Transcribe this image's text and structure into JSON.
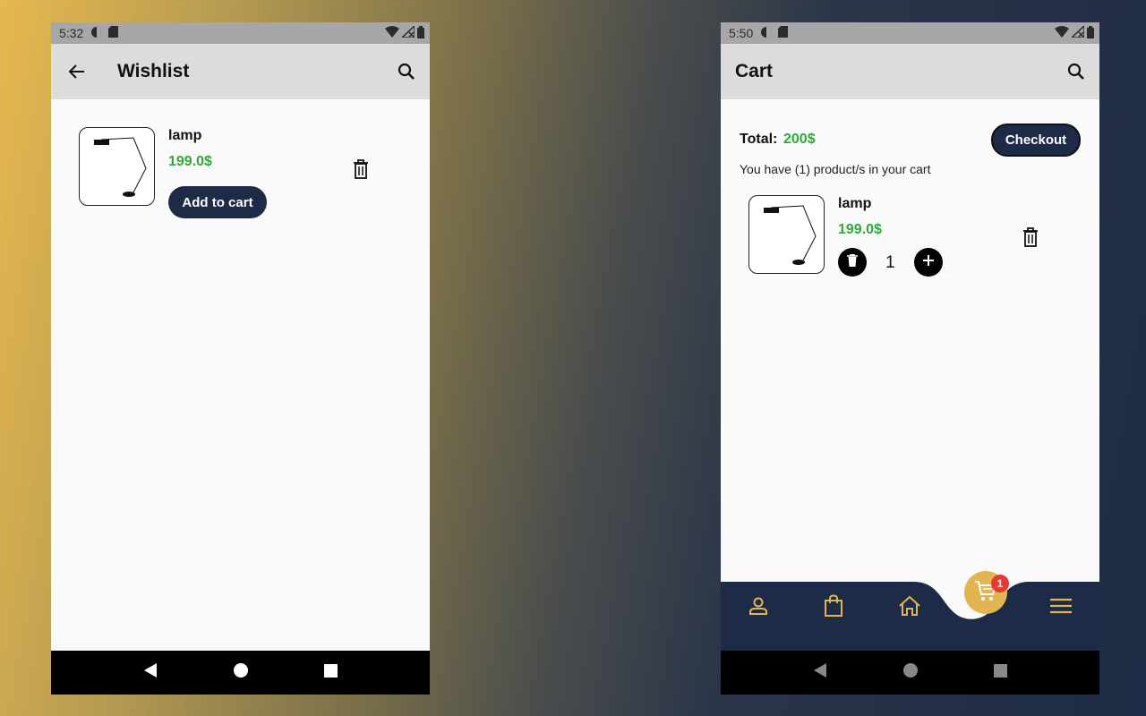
{
  "wishlist_screen": {
    "status": {
      "time": "5:32"
    },
    "appbar": {
      "title": "Wishlist"
    },
    "item": {
      "name": "lamp",
      "price": "199.0$",
      "add_to_cart_label": "Add to cart"
    }
  },
  "cart_screen": {
    "status": {
      "time": "5:50"
    },
    "appbar": {
      "title": "Cart"
    },
    "total_label": "Total:",
    "total_value": "200$",
    "checkout_label": "Checkout",
    "count_text": "You have (1) product/s in your cart",
    "item": {
      "name": "lamp",
      "price": "199.0$",
      "quantity": "1"
    },
    "bottom_nav": {
      "items": [
        "profile-icon",
        "shopping-bag-icon",
        "home-icon",
        "cart-icon",
        "menu-icon"
      ],
      "active": "cart-icon",
      "cart_badge": "1"
    }
  },
  "colors": {
    "accent": "#e3b452",
    "dark_navy": "#1d2b46",
    "price_green": "#30a83a",
    "badge_red": "#e53935"
  }
}
